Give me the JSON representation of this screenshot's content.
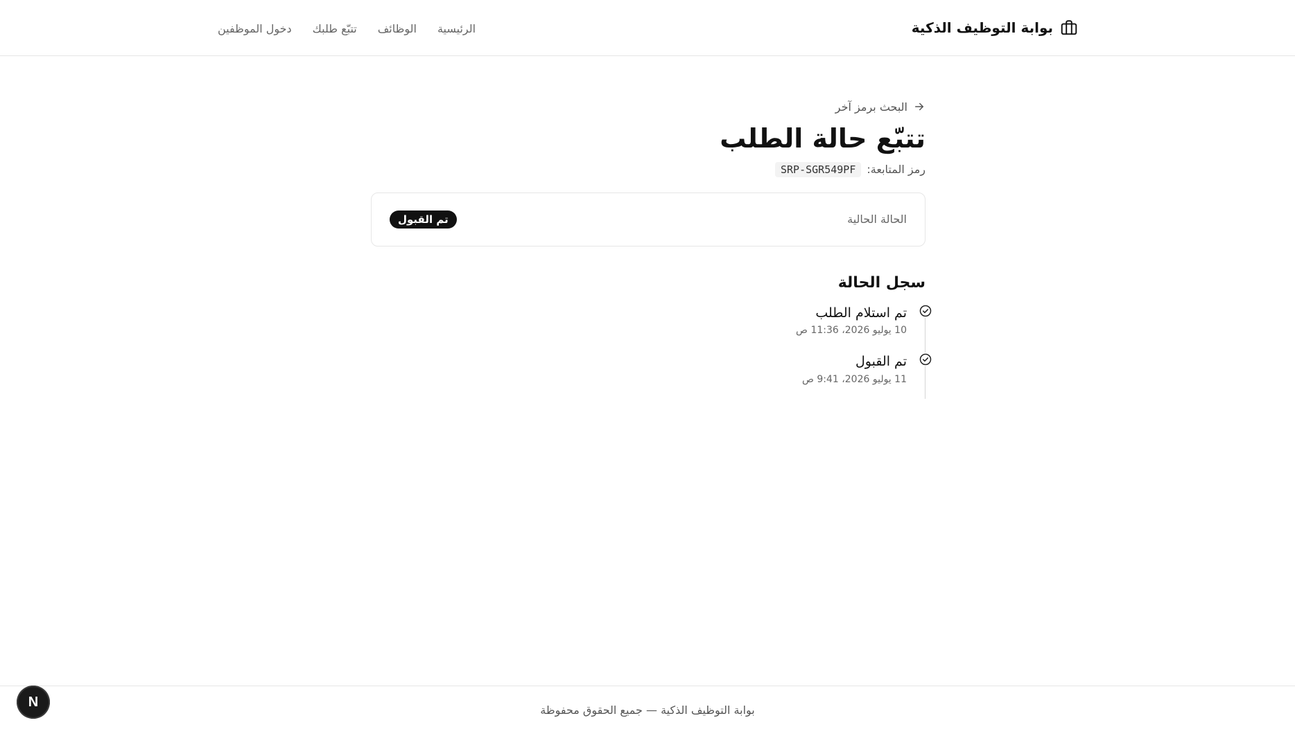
{
  "header": {
    "brand": "بوابة التوظيف الذكية",
    "nav": [
      {
        "label": "الرئيسية"
      },
      {
        "label": "الوظائف"
      },
      {
        "label": "تتبّع طلبك"
      },
      {
        "label": "دخول الموظفين"
      }
    ]
  },
  "main": {
    "back_link": "البحث برمز آخر",
    "title": "تتبّع حالة الطلب",
    "tracking_label": "رمز المتابعة:",
    "tracking_code": "SRP-SGR549PF",
    "status_card": {
      "label": "الحالة الحالية",
      "badge": "تم القبول"
    },
    "history": {
      "title": "سجل الحالة",
      "items": [
        {
          "title": "تم استلام الطلب",
          "date": "10 يوليو 2026، 11:36 ص"
        },
        {
          "title": "تم القبول",
          "date": "11 يوليو 2026، 9:41 ص"
        }
      ]
    }
  },
  "footer": {
    "text": "بوابة التوظيف الذكية — جميع الحقوق محفوظة"
  },
  "dev_badge": "N",
  "colors": {
    "text": "#111111",
    "muted": "#666666",
    "border": "#e6e6e6",
    "badge_bg": "#111111",
    "badge_text": "#ffffff"
  }
}
